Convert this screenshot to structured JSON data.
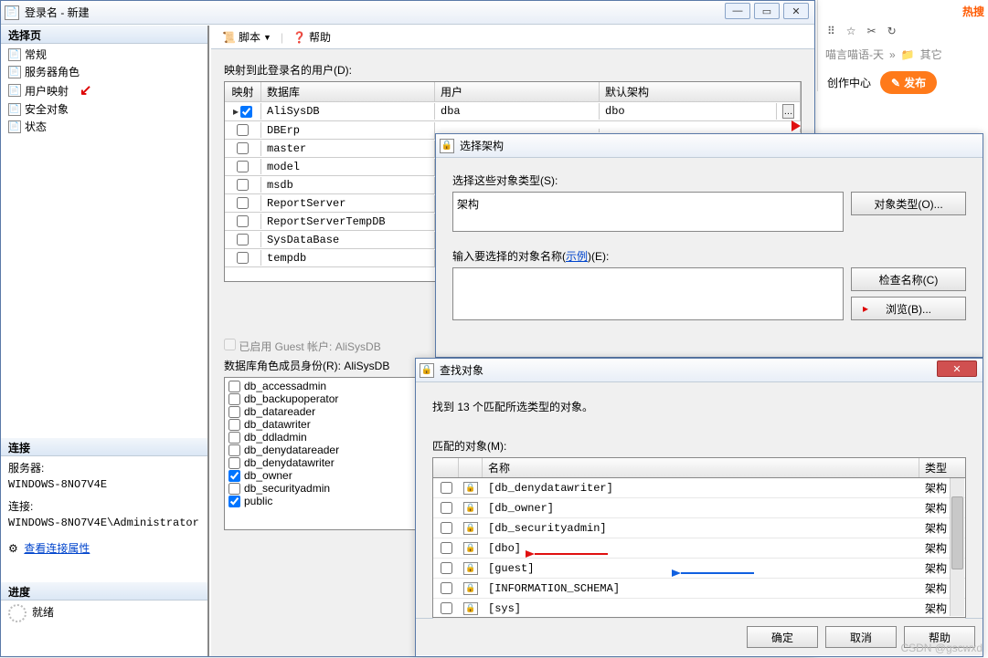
{
  "bg": {
    "hotsearch": "热搜",
    "breadcrumb": "喵言喵语-天",
    "other": "其它",
    "create": "创作中心",
    "publish": "发布"
  },
  "main_window": {
    "title": "登录名 - 新建",
    "side_header": "选择页",
    "nav": [
      "常规",
      "服务器角色",
      "用户映射",
      "安全对象",
      "状态"
    ],
    "toolbar": {
      "script": "脚本",
      "help": "帮助"
    },
    "map_label": "映射到此登录名的用户(D):",
    "grid_headers": {
      "map": "映射",
      "db": "数据库",
      "user": "用户",
      "schema": "默认架构"
    },
    "rows": [
      {
        "chk": true,
        "db": "AliSysDB",
        "user": "dba",
        "schema": "dbo",
        "btn": true,
        "sel": true
      },
      {
        "chk": false,
        "db": "DBErp"
      },
      {
        "chk": false,
        "db": "master"
      },
      {
        "chk": false,
        "db": "model"
      },
      {
        "chk": false,
        "db": "msdb"
      },
      {
        "chk": false,
        "db": "ReportServer"
      },
      {
        "chk": false,
        "db": "ReportServerTempDB"
      },
      {
        "chk": false,
        "db": "SysDataBase"
      },
      {
        "chk": false,
        "db": "tempdb"
      }
    ],
    "guest_label": "已启用 Guest 帐户: AliSysDB",
    "roles_label": "数据库角色成员身份(R): AliSysDB",
    "roles": [
      {
        "n": "db_accessadmin",
        "c": false
      },
      {
        "n": "db_backupoperator",
        "c": false
      },
      {
        "n": "db_datareader",
        "c": false
      },
      {
        "n": "db_datawriter",
        "c": false
      },
      {
        "n": "db_ddladmin",
        "c": false
      },
      {
        "n": "db_denydatareader",
        "c": false
      },
      {
        "n": "db_denydatawriter",
        "c": false
      },
      {
        "n": "db_owner",
        "c": true
      },
      {
        "n": "db_securityadmin",
        "c": false
      },
      {
        "n": "public",
        "c": true
      }
    ],
    "conn_header": "连接",
    "server_lbl": "服务器:",
    "server_val": "WINDOWS-8NO7V4E",
    "conn_lbl": "连接:",
    "conn_val": "WINDOWS-8NO7V4E\\Administrator",
    "view_conn": "查看连接属性",
    "progress_header": "进度",
    "ready": "就绪"
  },
  "schema_dialog": {
    "title": "选择架构",
    "select_types": "选择这些对象类型(S):",
    "schema_word": "架构",
    "obj_types_btn": "对象类型(O)...",
    "enter_names": "输入要选择的对象名称(",
    "example": "示例",
    "enter_names2": ")(E):",
    "check_names": "检查名称(C)",
    "browse": "浏览(B)..."
  },
  "find_dialog": {
    "title": "查找对象",
    "found": "找到 13 个匹配所选类型的对象。",
    "match_label": "匹配的对象(M):",
    "hdr_name": "名称",
    "hdr_type": "类型",
    "items": [
      {
        "n": "[db_denydatawriter]",
        "t": "架构"
      },
      {
        "n": "[db_owner]",
        "t": "架构"
      },
      {
        "n": "[db_securityadmin]",
        "t": "架构"
      },
      {
        "n": "[dbo]",
        "t": "架构"
      },
      {
        "n": "[guest]",
        "t": "架构"
      },
      {
        "n": "[INFORMATION_SCHEMA]",
        "t": "架构"
      },
      {
        "n": "[sys]",
        "t": "架构"
      }
    ],
    "ok": "确定",
    "cancel": "取消",
    "help": "帮助"
  },
  "watermark": "CSDN @gscwxd"
}
